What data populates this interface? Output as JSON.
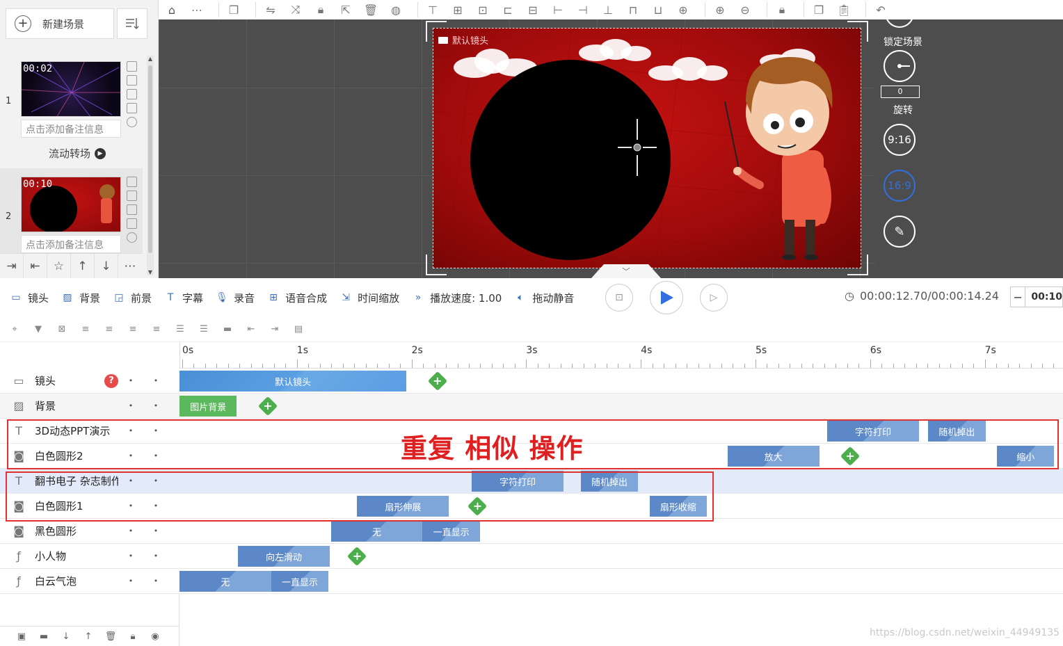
{
  "scene_panel": {
    "new_scene_label": "新建场景",
    "scenes": [
      {
        "num": "1",
        "time": "00:02",
        "note": "点击添加备注信息",
        "transition": "流动转场"
      },
      {
        "num": "2",
        "time": "00:10",
        "note": "点击添加备注信息"
      }
    ]
  },
  "stage": {
    "camera_label": "默认镜头"
  },
  "right_rail": {
    "lock_scene": "锁定场景",
    "rotation_value": "0",
    "rotate": "旋转",
    "ratio_9_16": "9:16",
    "ratio_16_9": "16:9"
  },
  "control_bar": {
    "camera": "镜头",
    "background": "背景",
    "foreground": "前景",
    "subtitle": "字幕",
    "record": "录音",
    "tts": "语音合成",
    "time_scale": "时间缩放",
    "speed": "播放速度: 1.00",
    "mute": "拖动静音",
    "time": "00:00:12.70/00:00:14.24",
    "zoom_value": "00:10"
  },
  "ruler": [
    "0s",
    "1s",
    "2s",
    "3s",
    "4s",
    "5s",
    "6s",
    "7s"
  ],
  "tracks": [
    {
      "name": "镜头",
      "icon": "camera-icon",
      "clips": [
        {
          "label": "默认镜头",
          "style": "blue",
          "start": 0.0,
          "end": 1.98
        }
      ],
      "add_at": 2.25
    },
    {
      "name": "背景",
      "icon": "background-icon",
      "clips": [
        {
          "label": "图片背景",
          "style": "green",
          "start": 0.0,
          "end": 0.5
        }
      ],
      "add_at": 0.77
    },
    {
      "name": "3D动态PPT演示",
      "icon": "text-icon",
      "clips": [
        {
          "label": "字符打印",
          "style": "blue2",
          "start": 5.65,
          "end": 6.45
        },
        {
          "label": "随机掉出",
          "style": "blue2",
          "start": 6.53,
          "end": 7.03
        }
      ]
    },
    {
      "name": "白色圆形2",
      "icon": "shape-icon",
      "clips": [
        {
          "label": "放大",
          "style": "blue2",
          "start": 4.78,
          "end": 5.58
        },
        {
          "label": "缩小",
          "style": "blue2",
          "start": 7.13,
          "end": 7.63
        }
      ],
      "add_at": 5.85
    },
    {
      "name": "翻书电子 杂志制作",
      "icon": "text-icon",
      "clips": [
        {
          "label": "字符打印",
          "style": "blue2",
          "start": 2.55,
          "end": 3.35
        },
        {
          "label": "随机掉出",
          "style": "blue2",
          "start": 3.5,
          "end": 4.0
        }
      ]
    },
    {
      "name": "白色圆形1",
      "icon": "shape-icon",
      "clips": [
        {
          "label": "扇形伸展",
          "style": "blue2",
          "start": 1.55,
          "end": 2.35
        },
        {
          "label": "扇形收缩",
          "style": "blue2",
          "start": 4.1,
          "end": 4.6
        }
      ],
      "add_at": 2.6
    },
    {
      "name": "黑色圆形",
      "icon": "shape-icon",
      "clips": [
        {
          "label": "无",
          "style": "blue2",
          "start": 1.32,
          "end": 2.12
        },
        {
          "label": "一直显示",
          "style": "blue2",
          "start": 2.12,
          "end": 2.62
        }
      ]
    },
    {
      "name": "小人物",
      "icon": "flash-icon",
      "clips": [
        {
          "label": "向左滑动",
          "style": "blue2",
          "start": 0.51,
          "end": 1.31
        }
      ],
      "add_at": 1.55
    },
    {
      "name": "白云气泡",
      "icon": "flash-icon",
      "clips": [
        {
          "label": "无",
          "style": "blue2",
          "start": 0.0,
          "end": 0.8
        },
        {
          "label": "一直显示",
          "style": "blue2",
          "start": 0.8,
          "end": 1.3
        }
      ]
    }
  ],
  "annotation": "重复 相似 操作",
  "watermark": "https://blog.csdn.net/weixin_44949135"
}
